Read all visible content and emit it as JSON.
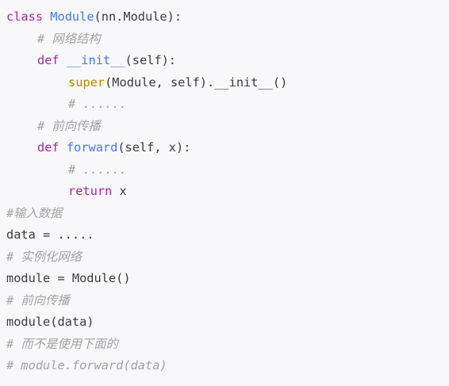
{
  "code": {
    "l1": {
      "kw": "class",
      "sp": " ",
      "name": "Module",
      "rest": "(nn.Module):"
    },
    "l2": {
      "comment": "# 网络结构"
    },
    "l3": {
      "kw": "def",
      "sp": " ",
      "name": "__init__",
      "rest": "(self):"
    },
    "l4": {
      "builtin": "super",
      "rest": "(Module, self).__init__()"
    },
    "l5": {
      "comment": "# ......"
    },
    "l6": {
      "comment": "# 前向传播"
    },
    "l7": {
      "kw": "def",
      "sp": " ",
      "name": "forward",
      "rest": "(self, x):"
    },
    "l8": {
      "comment": "# ......"
    },
    "l9": {
      "kw": "return",
      "rest": " x"
    },
    "l10": {
      "comment": "#输入数据"
    },
    "l11": {
      "text": "data = ....."
    },
    "l12": {
      "comment": "# 实例化网络"
    },
    "l13": {
      "text": "module = Module()"
    },
    "l14": {
      "comment": "# 前向传播"
    },
    "l15": {
      "text": "module(data)"
    },
    "l16": {
      "comment": "# 而不是使用下面的"
    },
    "l17": {
      "comment": "# module.forward(data)"
    }
  },
  "colors": {
    "keyword": "#a626a4",
    "function": "#4078f2",
    "builtin": "#c18401",
    "comment": "#a0a1a7",
    "text": "#383a42",
    "background": "#f8f8fa"
  }
}
